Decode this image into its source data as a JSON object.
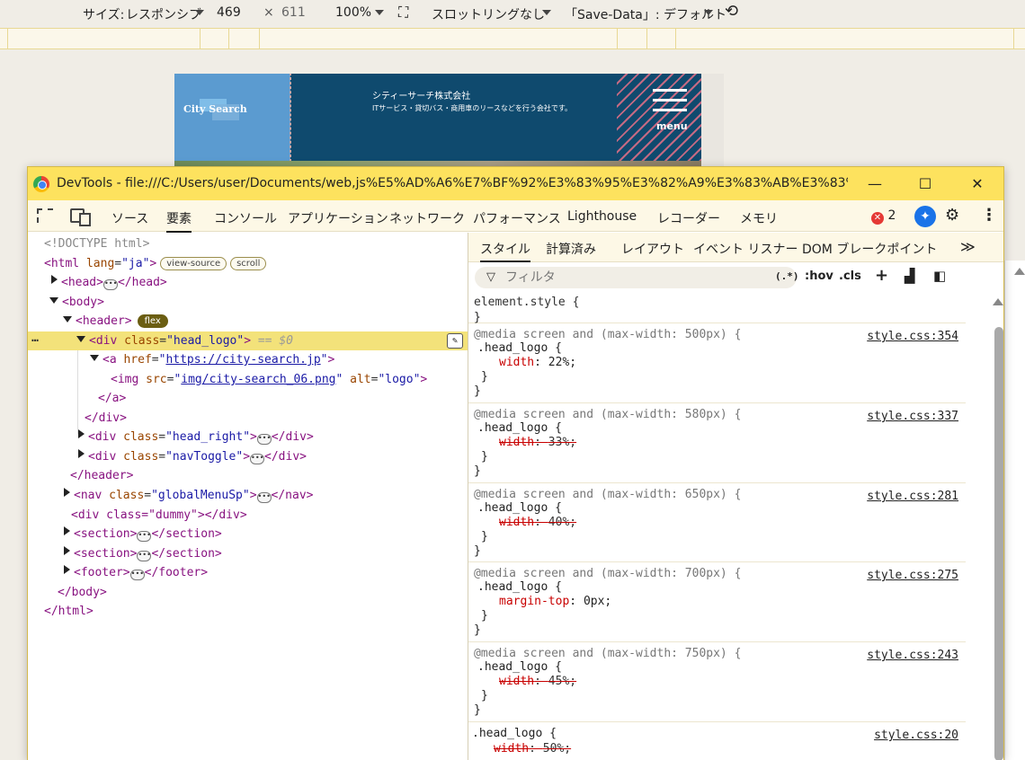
{
  "responsive_toolbar": {
    "size_label": "サイズ:",
    "mode": "レスポンシブ",
    "width": "469",
    "times": "×",
    "height": "611",
    "zoom": "100%",
    "slot_option": "スロットリングなし",
    "save_data": "「Save-Data」: デフォルト"
  },
  "site": {
    "logo_text": "City Search",
    "company_name": "シティーサーチ株式会社",
    "company_desc": "ITサービス・貸切バス・商用車のリースなどを行う会社です。",
    "menu_label": "menu"
  },
  "window": {
    "title": "DevTools - file:///C:/Users/user/Documents/web,js%E5%AD%A6%E7%BF%92%E3%83%95%E3%82%A9%E3%83%AB%E3%83%80/%...",
    "minimize": "—",
    "maximize": "☐",
    "close": "✕"
  },
  "panel_tabs": [
    "ソース",
    "要素",
    "コンソール",
    "アプリケーション",
    "ネットワーク",
    "パフォーマンス",
    "Lighthouse",
    "レコーダー",
    "メモリ"
  ],
  "active_panel": "要素",
  "error_count": "2",
  "elements": {
    "doctype": "<!DOCTYPE html>",
    "html_open": "<html",
    "lang_attr": "lang",
    "lang_val": "\"ja\"",
    "view_source": "view-source",
    "scroll": "scroll",
    "head": "<head>",
    "head_close": "</head>",
    "body": "<body>",
    "header": "<header>",
    "flex": "flex",
    "div_open": "<div",
    "class_attr": "class",
    "head_logo_val": "\"head_logo\"",
    "selected_suffix": "== $0",
    "a_open": "<a",
    "href_attr": "href",
    "href_val": "https://city-search.jp",
    "img_open": "<img",
    "src_attr": "src",
    "src_val": "img/city-search_06.png",
    "alt_attr": "alt",
    "alt_val": "\"logo\"",
    "a_close": "</a>",
    "div_close": "</div>",
    "head_right_val": "\"head_right\"",
    "nav_toggle_val": "\"navToggle\"",
    "header_close": "</header>",
    "nav_open": "<nav",
    "global_menu_val": "\"globalMenuSp\"",
    "nav_close": "</nav>",
    "dummy_line": "<div class=\"dummy\"></div>",
    "section": "<section>",
    "section_close": "</section>",
    "footer": "<footer>",
    "footer_close": "</footer>",
    "body_close": "</body>",
    "html_close": "</html>"
  },
  "style_tabs": [
    "スタイル",
    "計算済み",
    "レイアウト",
    "イベント リスナー",
    "DOM ブレークポイント"
  ],
  "active_style_tab": "スタイル",
  "filter": {
    "placeholder": "フィルタ",
    "regex": "(.*)",
    "hov": ":hov",
    "cls": ".cls"
  },
  "rules": [
    {
      "media": "",
      "selector": "element.style {",
      "prop": "",
      "value": "",
      "strike": false,
      "source": ""
    },
    {
      "media": "@media screen and (max-width: 500px) {",
      "selector": ".head_logo {",
      "prop": "width",
      "value": "22%;",
      "strike": false,
      "source": "style.css:354"
    },
    {
      "media": "@media screen and (max-width: 580px) {",
      "selector": ".head_logo {",
      "prop": "width",
      "value": "33%;",
      "strike": true,
      "source": "style.css:337"
    },
    {
      "media": "@media screen and (max-width: 650px) {",
      "selector": ".head_logo {",
      "prop": "width",
      "value": "40%;",
      "strike": true,
      "source": "style.css:281"
    },
    {
      "media": "@media screen and (max-width: 700px) {",
      "selector": ".head_logo {",
      "prop": "margin-top",
      "value": "0px;",
      "strike": false,
      "source": "style.css:275"
    },
    {
      "media": "@media screen and (max-width: 750px) {",
      "selector": ".head_logo {",
      "prop": "width",
      "value": "45%;",
      "strike": true,
      "source": "style.css:243"
    },
    {
      "media": "",
      "selector": ".head_logo {",
      "prop": "width",
      "value": "50%;",
      "strike": true,
      "source": "style.css:20"
    }
  ],
  "closing_brace": "}"
}
